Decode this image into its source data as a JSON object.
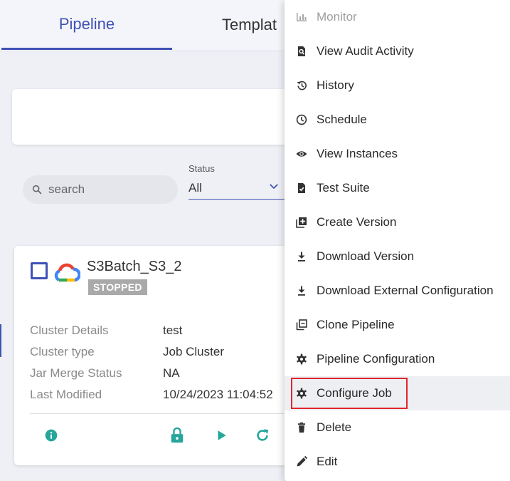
{
  "tabs": [
    {
      "label": "Pipeline",
      "active": true
    },
    {
      "label": "Templat"
    }
  ],
  "filters": {
    "search_placeholder": "search",
    "status_label": "Status",
    "status_value": "All"
  },
  "pipeline_card": {
    "name": "S3Batch_S3_2",
    "status": "STOPPED",
    "details": [
      {
        "key": "Cluster Details",
        "value": "test"
      },
      {
        "key": "Cluster type",
        "value": "Job Cluster"
      },
      {
        "key": "Jar Merge Status",
        "value": "NA"
      },
      {
        "key": "Last Modified",
        "value": "10/24/2023 11:04:52"
      }
    ],
    "actions": [
      "info-icon",
      "lock-icon",
      "play-icon",
      "refresh-icon"
    ],
    "action_color": "#26a69a"
  },
  "menu": {
    "items": [
      {
        "label": "Monitor",
        "icon": "bar-chart-icon",
        "disabled": true
      },
      {
        "label": "View Audit Activity",
        "icon": "audit-search-icon"
      },
      {
        "label": "History",
        "icon": "history-icon"
      },
      {
        "label": "Schedule",
        "icon": "clock-icon"
      },
      {
        "label": "View Instances",
        "icon": "eye-icon"
      },
      {
        "label": "Test Suite",
        "icon": "file-check-icon"
      },
      {
        "label": "Create Version",
        "icon": "add-box-icon"
      },
      {
        "label": "Download Version",
        "icon": "download-icon"
      },
      {
        "label": "Download External Configuration",
        "icon": "download-icon"
      },
      {
        "label": "Clone Pipeline",
        "icon": "clone-icon"
      },
      {
        "label": "Pipeline Configuration",
        "icon": "gear-icon"
      },
      {
        "label": "Configure Job",
        "icon": "gear-icon",
        "highlighted": true
      },
      {
        "label": "Delete",
        "icon": "trash-icon"
      },
      {
        "label": "Edit",
        "icon": "pencil-icon"
      }
    ]
  },
  "colors": {
    "accent": "#3f51b5",
    "highlight_border": "#e0252e",
    "badge_bg": "#a9a9a9"
  }
}
